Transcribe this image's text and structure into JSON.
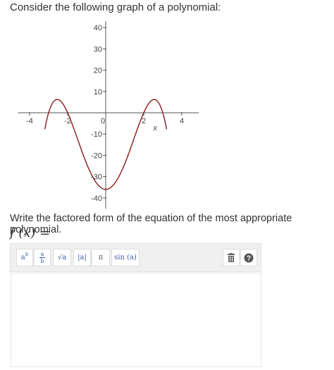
{
  "question_text": "Consider the following graph of a polynomial:",
  "instruction_text": "Write the factored form of the equation of the most appropriate polynomial.",
  "answer_label": "f (x) =",
  "toolbar": {
    "power_base": "a",
    "power_exp": "b",
    "frac_num": "a",
    "frac_den": "b",
    "sqrt_label": "√a",
    "abs_label": "|a|",
    "pi_label": "π",
    "sin_label": "sin (a)",
    "trash_icon": "trash-icon",
    "help_icon": "help-circle-icon",
    "help_glyph": "?"
  },
  "colors": {
    "curve": "#8b1a1a",
    "axis": "#555555",
    "toolbar_bg": "#f0f0f0"
  },
  "chart_data": {
    "type": "line",
    "xlabel": "x",
    "xlim": [
      -4.5,
      4.9
    ],
    "ylim": [
      -45,
      43
    ],
    "x_ticks": [
      -4,
      -2,
      0,
      2,
      4
    ],
    "x_tick_labels": [
      "-4",
      "-2",
      "0",
      "2",
      "4"
    ],
    "y_ticks": [
      40,
      30,
      20,
      10,
      -10,
      -20,
      -30,
      -40
    ],
    "y_tick_labels": [
      "40",
      "30",
      "20",
      "10",
      "-10",
      "-20",
      "-30",
      "-40"
    ],
    "series": [
      {
        "roots": [
          -3,
          -2,
          2,
          3
        ],
        "y_at_0": -36,
        "points": [
          [
            -3.2,
            -10.1
          ],
          [
            -3,
            0
          ],
          [
            -2.5,
            5.1
          ],
          [
            -2,
            0
          ],
          [
            -1,
            -24
          ],
          [
            0,
            -36
          ],
          [
            1,
            -24
          ],
          [
            2,
            0
          ],
          [
            2.5,
            5.1
          ],
          [
            3,
            0
          ],
          [
            3.2,
            -10.1
          ]
        ]
      }
    ]
  }
}
